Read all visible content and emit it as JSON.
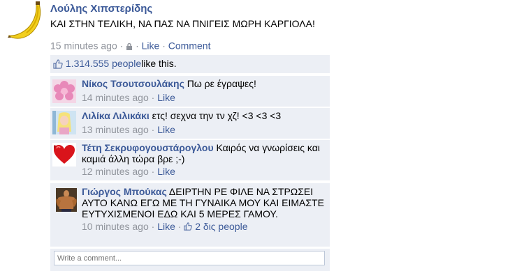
{
  "post": {
    "author": "Λούλης Χιπστερίδης",
    "text": "ΚΑΙ ΣΤΗΝ ΤΕΛΙΚΗ, ΝΑ ΠΑΣ ΝΑ ΠΝΙΓΕΙΣ ΜΩΡΗ ΚΑΡΓΙΟΛΑ!",
    "time": "15 minutes ago",
    "like_label": "Like",
    "comment_label": "Comment",
    "avatar_icon": "banana-icon",
    "privacy_icon": "lock-icon"
  },
  "likes": {
    "count_text": "1.314.555 people",
    "suffix": "like this.",
    "icon": "thumbs-up-icon"
  },
  "comments": [
    {
      "author": "Νίκος Τσουτσουλάκης",
      "text": "Πω ρε έγραψες!",
      "time": "14 minutes ago",
      "like_label": "Like",
      "avatar": "flower-avatar"
    },
    {
      "author": "Λιλίκα Λιλικάκι",
      "text": "ετς! σεχνα την τν χζ! <3 <3 <3",
      "time": "13 minutes ago",
      "like_label": "Like",
      "avatar": "doll-avatar"
    },
    {
      "author": "Τέτη Σεκρυφογουστάρογλου",
      "text": "Καιρός να γνωρίσεις και καμιά άλλη τώρα βρε ;-)",
      "time": "12 minutes ago",
      "like_label": "Like",
      "avatar": "hearts-avatar"
    },
    {
      "author": "Γιώργος Μπούκας",
      "text": "ΔΕΙΡΤΗΝ ΡΕ ΦΙΛΕ ΝΑ ΣΤΡΩΣΕΙ ΑΥΤΟ ΚΑΝΩ ΕΓΩ ΜΕ ΤΗ ΓΥΝΑΙΚΑ ΜΟΥ ΚΑΙ ΕΙΜΑΣΤΕ ΕΥΤΥΧΙΣΜΕΝΟΙ ΕΔΩ ΚΑΙ 5 ΜΕΡΕΣ ΓΑΜΟΥ.",
      "time": "10 minutes ago",
      "like_label": "Like",
      "likes_text": "2 δις people",
      "avatar": "bodybuilder-avatar"
    }
  ],
  "composer": {
    "placeholder": "Write a comment..."
  },
  "colors": {
    "link": "#3b5998",
    "meta": "#90949c",
    "panel_bg": "#eceff5"
  }
}
